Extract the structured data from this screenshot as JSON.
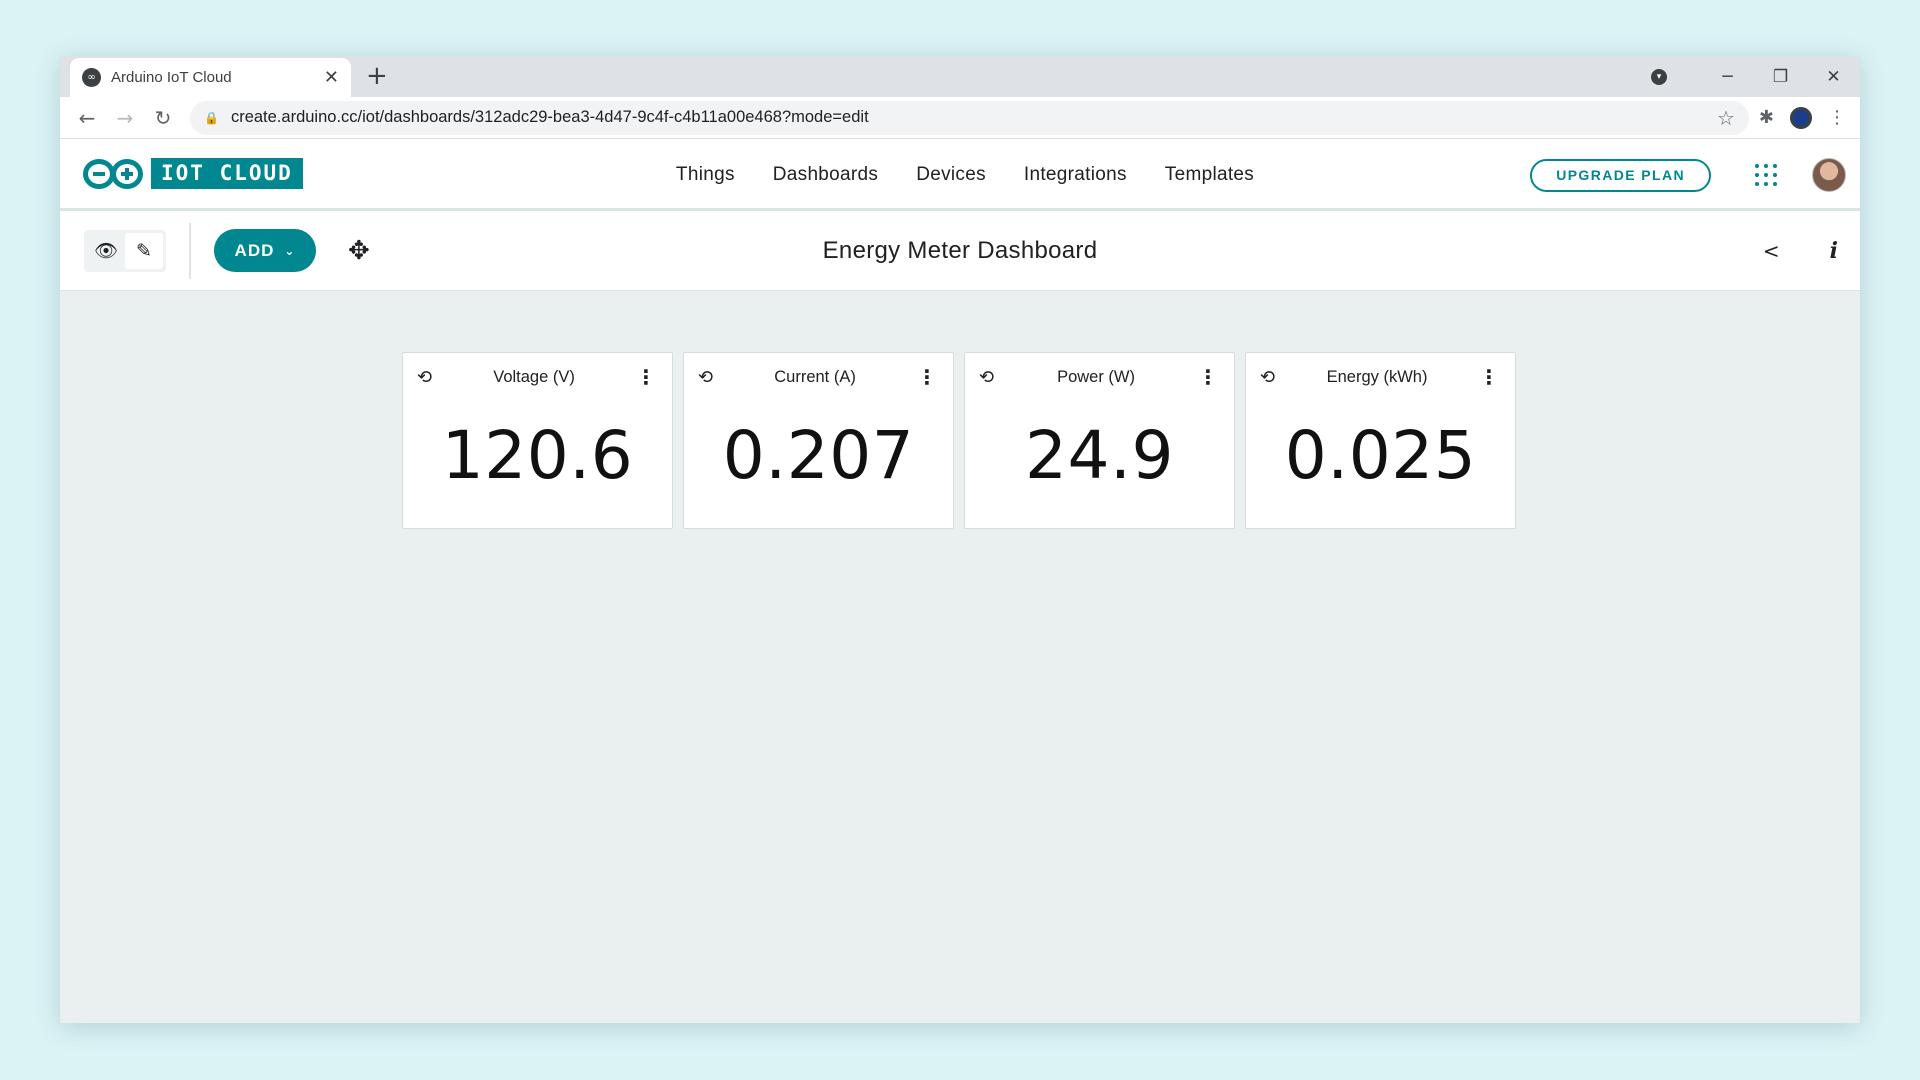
{
  "browser": {
    "tab_title": "Arduino IoT Cloud",
    "tab_close_glyph": "✕",
    "new_tab_glyph": "+",
    "url": "create.arduino.cc/iot/dashboards/312adc29-bea3-4d47-9c4f-c4b11a00e468?mode=edit"
  },
  "header": {
    "logo_text": "IOT CLOUD",
    "nav": [
      "Things",
      "Dashboards",
      "Devices",
      "Integrations",
      "Templates"
    ],
    "upgrade_label": "UPGRADE PLAN",
    "accent_color": "#00878f"
  },
  "dashboard": {
    "title": "Energy Meter Dashboard",
    "add_label": "ADD",
    "mode": "edit"
  },
  "widgets": [
    {
      "title": "Voltage (V)",
      "value": "120.6"
    },
    {
      "title": "Current (A)",
      "value": "0.207"
    },
    {
      "title": "Power (W)",
      "value": "24.9"
    },
    {
      "title": "Energy (kWh)",
      "value": "0.025"
    }
  ]
}
